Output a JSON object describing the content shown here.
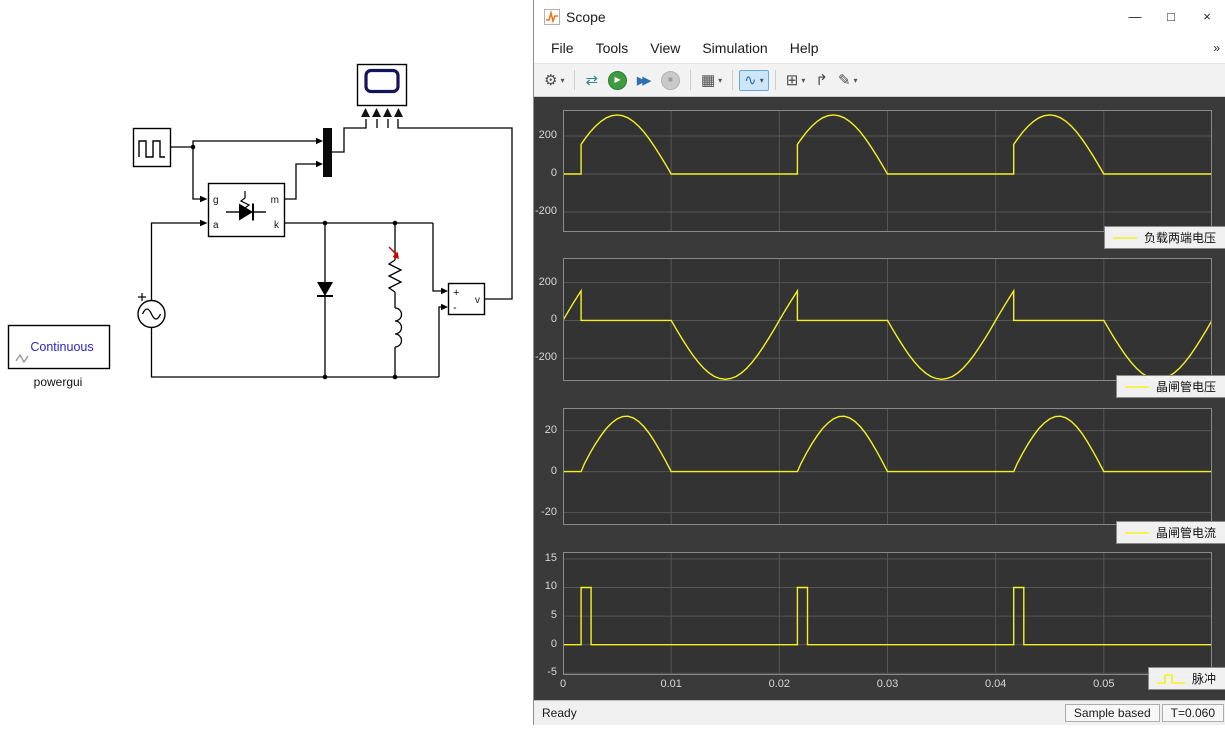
{
  "scope": {
    "title": "Scope",
    "menu": [
      "File",
      "Tools",
      "View",
      "Simulation",
      "Help"
    ],
    "controls": {
      "minimize": "—",
      "maximize": "□",
      "close": "×"
    },
    "menu_overflow": "»"
  },
  "toolbar": {
    "caret": "▾",
    "items": [
      {
        "name": "settings",
        "glyph": "⚙"
      },
      {
        "name": "highlight-simulink-block",
        "glyph": "⇄"
      },
      {
        "name": "run",
        "glyph": "▶"
      },
      {
        "name": "step-forward",
        "glyph": "▶▶"
      },
      {
        "name": "stop",
        "glyph": "■"
      },
      {
        "name": "layouts",
        "glyph": "▦"
      },
      {
        "name": "trigger",
        "glyph": "∿"
      },
      {
        "name": "zoom-pan",
        "glyph": "⊞"
      },
      {
        "name": "bring-forward",
        "glyph": "↱"
      },
      {
        "name": "measurements",
        "glyph": "✎"
      }
    ]
  },
  "statusbar": {
    "ready": "Ready",
    "cells": [
      "Sample based",
      "T=0.060"
    ]
  },
  "model": {
    "powergui_mode": "Continuous",
    "powergui_label": "powergui",
    "ports": {
      "g": "g",
      "m": "m",
      "a": "a",
      "k": "k"
    },
    "vm": {
      "plus": "+",
      "minus": "-",
      "out": "v"
    }
  },
  "colors": {
    "trace": "#f6f122",
    "axes_bg": "#333333",
    "figure_bg": "#3a3a3a",
    "grid": "#565656",
    "axes_border": "#8a8a8a"
  },
  "chart_data": [
    {
      "type": "line",
      "legend": "负载两端电压",
      "color": "#f6f122",
      "xlim": [
        0,
        0.06
      ],
      "ylim": [
        -305,
        337
      ],
      "xticks": [
        0,
        0.01,
        0.02,
        0.03,
        0.04,
        0.05
      ],
      "yticks": [
        200,
        0,
        -200
      ],
      "points": [
        [
          0,
          0
        ],
        [
          0.00167,
          0
        ],
        [
          0.00167,
          156
        ],
        [
          0.002,
          183
        ],
        [
          0.0025,
          220
        ],
        [
          0.003,
          252
        ],
        [
          0.0035,
          277
        ],
        [
          0.004,
          296
        ],
        [
          0.0045,
          307
        ],
        [
          0.005,
          311
        ],
        [
          0.0055,
          307
        ],
        [
          0.006,
          296
        ],
        [
          0.0065,
          277
        ],
        [
          0.007,
          252
        ],
        [
          0.0075,
          220
        ],
        [
          0.008,
          183
        ],
        [
          0.0085,
          141
        ],
        [
          0.009,
          96
        ],
        [
          0.0095,
          49
        ],
        [
          0.01,
          0
        ],
        [
          0.02167,
          0
        ],
        [
          0.02167,
          156
        ],
        [
          0.022,
          183
        ],
        [
          0.0225,
          220
        ],
        [
          0.023,
          252
        ],
        [
          0.0235,
          277
        ],
        [
          0.024,
          296
        ],
        [
          0.0245,
          307
        ],
        [
          0.025,
          311
        ],
        [
          0.0255,
          307
        ],
        [
          0.026,
          296
        ],
        [
          0.0265,
          277
        ],
        [
          0.027,
          252
        ],
        [
          0.0275,
          220
        ],
        [
          0.028,
          183
        ],
        [
          0.0285,
          141
        ],
        [
          0.029,
          96
        ],
        [
          0.0295,
          49
        ],
        [
          0.03,
          0
        ],
        [
          0.04167,
          0
        ],
        [
          0.04167,
          156
        ],
        [
          0.042,
          183
        ],
        [
          0.0425,
          220
        ],
        [
          0.043,
          252
        ],
        [
          0.0435,
          277
        ],
        [
          0.044,
          296
        ],
        [
          0.0445,
          307
        ],
        [
          0.045,
          311
        ],
        [
          0.0455,
          307
        ],
        [
          0.046,
          296
        ],
        [
          0.0465,
          277
        ],
        [
          0.047,
          252
        ],
        [
          0.0475,
          220
        ],
        [
          0.048,
          183
        ],
        [
          0.0485,
          141
        ],
        [
          0.049,
          96
        ],
        [
          0.0495,
          49
        ],
        [
          0.05,
          0
        ],
        [
          0.06,
          0
        ]
      ]
    },
    {
      "type": "line",
      "legend": "晶闸管电压",
      "color": "#f6f122",
      "xlim": [
        0,
        0.06
      ],
      "ylim": [
        -320,
        330
      ],
      "xticks": [
        0,
        0.01,
        0.02,
        0.03,
        0.04,
        0.05
      ],
      "yticks": [
        200,
        0,
        -200
      ],
      "points": [
        [
          0,
          0
        ],
        [
          0.0005,
          49
        ],
        [
          0.001,
          96
        ],
        [
          0.0015,
          141
        ],
        [
          0.00167,
          156
        ],
        [
          0.00167,
          0
        ],
        [
          0.01,
          0
        ],
        [
          0.0105,
          -49
        ],
        [
          0.011,
          -96
        ],
        [
          0.0115,
          -141
        ],
        [
          0.012,
          -183
        ],
        [
          0.0125,
          -220
        ],
        [
          0.013,
          -252
        ],
        [
          0.0135,
          -277
        ],
        [
          0.014,
          -296
        ],
        [
          0.0145,
          -307
        ],
        [
          0.015,
          -311
        ],
        [
          0.0155,
          -307
        ],
        [
          0.016,
          -296
        ],
        [
          0.0165,
          -277
        ],
        [
          0.017,
          -252
        ],
        [
          0.0175,
          -220
        ],
        [
          0.018,
          -183
        ],
        [
          0.0185,
          -141
        ],
        [
          0.019,
          -96
        ],
        [
          0.0195,
          -49
        ],
        [
          0.02,
          0
        ],
        [
          0.0205,
          49
        ],
        [
          0.021,
          96
        ],
        [
          0.0215,
          141
        ],
        [
          0.02167,
          156
        ],
        [
          0.02167,
          0
        ],
        [
          0.03,
          0
        ],
        [
          0.0305,
          -49
        ],
        [
          0.031,
          -96
        ],
        [
          0.0315,
          -141
        ],
        [
          0.032,
          -183
        ],
        [
          0.0325,
          -220
        ],
        [
          0.033,
          -252
        ],
        [
          0.0335,
          -277
        ],
        [
          0.034,
          -296
        ],
        [
          0.0345,
          -307
        ],
        [
          0.035,
          -311
        ],
        [
          0.0355,
          -307
        ],
        [
          0.036,
          -296
        ],
        [
          0.0365,
          -277
        ],
        [
          0.037,
          -252
        ],
        [
          0.0375,
          -220
        ],
        [
          0.038,
          -183
        ],
        [
          0.0385,
          -141
        ],
        [
          0.039,
          -96
        ],
        [
          0.0395,
          -49
        ],
        [
          0.04,
          0
        ],
        [
          0.0405,
          49
        ],
        [
          0.041,
          96
        ],
        [
          0.0415,
          141
        ],
        [
          0.04167,
          156
        ],
        [
          0.04167,
          0
        ],
        [
          0.05,
          0
        ],
        [
          0.0505,
          -49
        ],
        [
          0.051,
          -96
        ],
        [
          0.0515,
          -141
        ],
        [
          0.052,
          -183
        ],
        [
          0.0525,
          -220
        ],
        [
          0.053,
          -252
        ],
        [
          0.0535,
          -277
        ],
        [
          0.054,
          -296
        ],
        [
          0.0545,
          -307
        ],
        [
          0.055,
          -311
        ],
        [
          0.0555,
          -307
        ],
        [
          0.056,
          -296
        ],
        [
          0.0565,
          -277
        ],
        [
          0.057,
          -252
        ],
        [
          0.0575,
          -220
        ],
        [
          0.058,
          -183
        ],
        [
          0.0585,
          -141
        ],
        [
          0.059,
          -96
        ],
        [
          0.0595,
          -49
        ],
        [
          0.06,
          0
        ]
      ]
    },
    {
      "type": "line",
      "legend": "晶闸管电流",
      "color": "#f6f122",
      "xlim": [
        0,
        0.06
      ],
      "ylim": [
        -26,
        31
      ],
      "xticks": [
        0,
        0.01,
        0.02,
        0.03,
        0.04,
        0.05
      ],
      "yticks": [
        20,
        0,
        -20
      ],
      "points": [
        [
          0,
          0
        ],
        [
          0.00167,
          0
        ],
        [
          0.002,
          4
        ],
        [
          0.0025,
          9
        ],
        [
          0.003,
          13.5
        ],
        [
          0.0035,
          17.5
        ],
        [
          0.004,
          21
        ],
        [
          0.0045,
          23.7
        ],
        [
          0.005,
          25.7
        ],
        [
          0.0055,
          26.8
        ],
        [
          0.006,
          27
        ],
        [
          0.0065,
          26.2
        ],
        [
          0.007,
          24.4
        ],
        [
          0.0075,
          21.8
        ],
        [
          0.008,
          18.5
        ],
        [
          0.0085,
          14.4
        ],
        [
          0.009,
          9.9
        ],
        [
          0.0095,
          5.1
        ],
        [
          0.01,
          0
        ],
        [
          0.02167,
          0
        ],
        [
          0.022,
          4
        ],
        [
          0.0225,
          9
        ],
        [
          0.023,
          13.5
        ],
        [
          0.0235,
          17.5
        ],
        [
          0.024,
          21
        ],
        [
          0.0245,
          23.7
        ],
        [
          0.025,
          25.7
        ],
        [
          0.0255,
          26.8
        ],
        [
          0.026,
          27
        ],
        [
          0.0265,
          26.2
        ],
        [
          0.027,
          24.4
        ],
        [
          0.0275,
          21.8
        ],
        [
          0.028,
          18.5
        ],
        [
          0.0285,
          14.4
        ],
        [
          0.029,
          9.9
        ],
        [
          0.0295,
          5.1
        ],
        [
          0.03,
          0
        ],
        [
          0.04167,
          0
        ],
        [
          0.042,
          4
        ],
        [
          0.0425,
          9
        ],
        [
          0.043,
          13.5
        ],
        [
          0.0435,
          17.5
        ],
        [
          0.044,
          21
        ],
        [
          0.0445,
          23.7
        ],
        [
          0.045,
          25.7
        ],
        [
          0.0455,
          26.8
        ],
        [
          0.046,
          27
        ],
        [
          0.0465,
          26.2
        ],
        [
          0.047,
          24.4
        ],
        [
          0.0475,
          21.8
        ],
        [
          0.048,
          18.5
        ],
        [
          0.0485,
          14.4
        ],
        [
          0.049,
          9.9
        ],
        [
          0.0495,
          5.1
        ],
        [
          0.05,
          0
        ],
        [
          0.06,
          0
        ]
      ]
    },
    {
      "type": "line",
      "legend": "脉冲",
      "color": "#f6f122",
      "xlim": [
        0,
        0.06
      ],
      "ylim": [
        -5.3,
        16.2
      ],
      "xticks": [
        0,
        0.01,
        0.02,
        0.03,
        0.04,
        0.05
      ],
      "x_tick_labels": [
        "0",
        "0.01",
        "0.02",
        "0.03",
        "0.04",
        "0.05"
      ],
      "yticks": [
        15,
        10,
        5,
        0,
        -5
      ],
      "points": [
        [
          0,
          0
        ],
        [
          0.00167,
          0
        ],
        [
          0.00167,
          10
        ],
        [
          0.0026,
          10
        ],
        [
          0.0026,
          0
        ],
        [
          0.02167,
          0
        ],
        [
          0.02167,
          10
        ],
        [
          0.0226,
          10
        ],
        [
          0.0226,
          0
        ],
        [
          0.04167,
          0
        ],
        [
          0.04167,
          10
        ],
        [
          0.0426,
          10
        ],
        [
          0.0426,
          0
        ],
        [
          0.06,
          0
        ]
      ]
    }
  ]
}
